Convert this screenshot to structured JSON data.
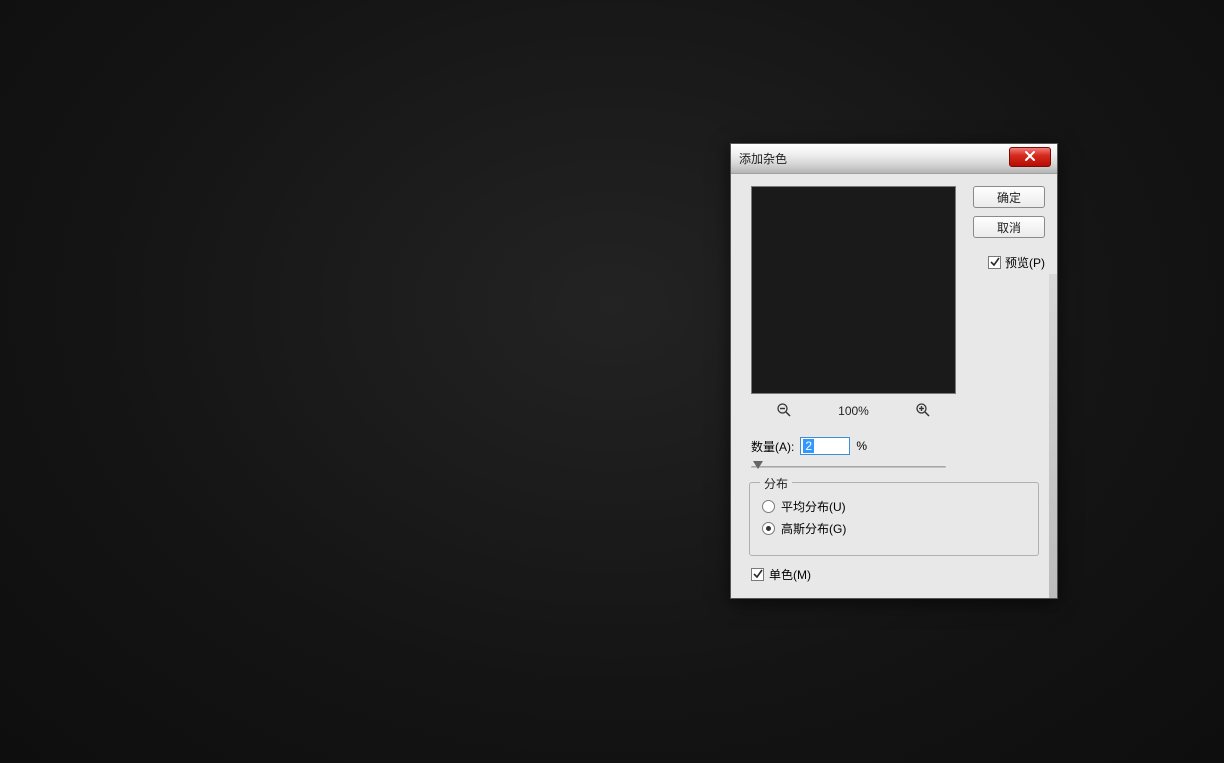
{
  "dialog": {
    "title": "添加杂色",
    "ok_label": "确定",
    "cancel_label": "取消",
    "preview_label": "预览(P)",
    "preview_checked": true,
    "zoom_level": "100%",
    "amount": {
      "label": "数量(A):",
      "value": "2",
      "unit": "%"
    },
    "distribution": {
      "legend": "分布",
      "options": [
        {
          "label": "平均分布(U)",
          "selected": false
        },
        {
          "label": "高斯分布(G)",
          "selected": true
        }
      ]
    },
    "monochrome": {
      "label": "单色(M)",
      "checked": true
    },
    "icons": {
      "zoom_out": "minus-magnifier",
      "zoom_in": "plus-magnifier"
    }
  }
}
